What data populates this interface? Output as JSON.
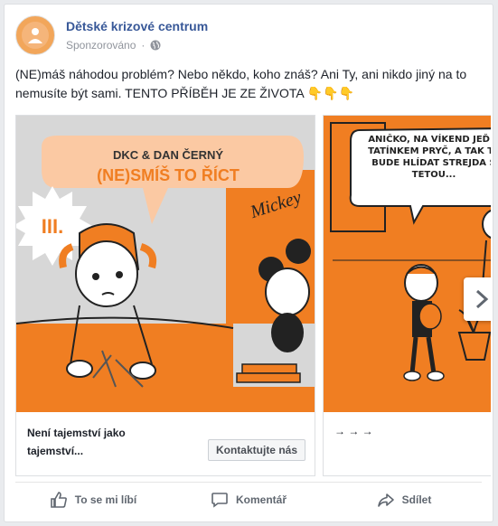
{
  "post": {
    "page_name": "Dětské krizové centrum",
    "sponsored_label": "Sponzorováno",
    "text": "(NE)máš náhodou problém? Nebo někdo, koho znáš? Ani Ty, ani nikdo jiný na to nemusíte být sami. TENTO PŘÍBĚH JE ZE ŽIVOTA 👇👇👇"
  },
  "carousel": {
    "slides": [
      {
        "bubble_line1": "DKC & DAN ČERNÝ",
        "bubble_line2": "(NE)SMÍŠ TO ŘÍCT",
        "roman": "III.",
        "poster_text": "Mickey",
        "title": "Není tajemství jako tajemství...",
        "cta": "Kontaktujte nás"
      },
      {
        "speech": "ANIČKO, NA VÍKEND JEĎ S TATÍNKEM PRYČ, A TAK TĚ BUDE HLÍDAT STREJDA S TETOU...",
        "title": "→ → →"
      }
    ]
  },
  "actions": {
    "like": "To se mi líbí",
    "comment": "Komentář",
    "share": "Sdílet"
  },
  "colors": {
    "link": "#385898",
    "orange": "#f07e22",
    "peach": "#fbc9a3"
  },
  "icons": [
    "globe-icon",
    "chevron-right-icon",
    "thumbs-up-icon",
    "comment-icon",
    "share-icon"
  ]
}
